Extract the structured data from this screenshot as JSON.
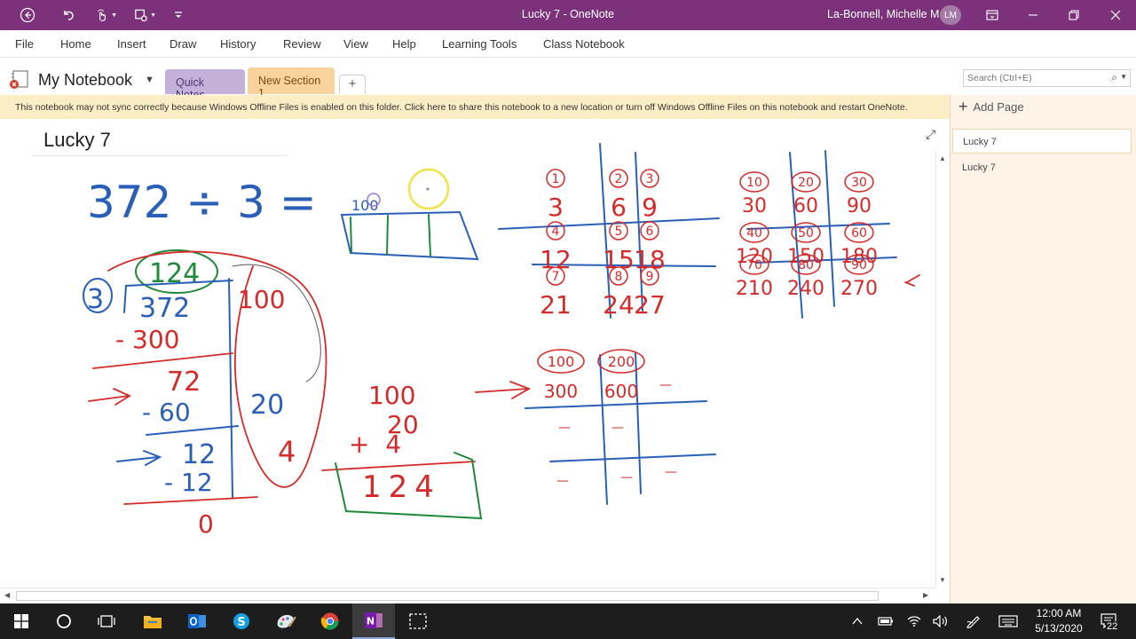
{
  "window": {
    "title": "Lucky 7  -  OneNote",
    "user_name": "La-Bonnell, Michelle M",
    "user_initials": "LM"
  },
  "menu": {
    "items": [
      "File",
      "Home",
      "Insert",
      "Draw",
      "History",
      "Review",
      "View",
      "Help",
      "Learning Tools",
      "Class Notebook"
    ]
  },
  "notebook": {
    "name": "My Notebook",
    "sections": [
      {
        "label": "Quick Notes",
        "color": "#c4b1d9"
      },
      {
        "label": "New Section 1",
        "color": "#f9d29c"
      }
    ],
    "add_section": "+"
  },
  "search": {
    "placeholder": "Search (Ctrl+E)"
  },
  "warning": {
    "text": "This notebook may not sync correctly because Windows Offline Files is enabled on this folder. Click here to share this notebook to a new location or turn off Windows Offline Files on this notebook and restart OneNote."
  },
  "page_pane": {
    "add_page": "Add Page",
    "pages": [
      "Lucky 7",
      "Lucky 7"
    ]
  },
  "page": {
    "title": "Lucky 7"
  },
  "ink_text": {
    "problem": "372 ÷ 3 =",
    "box_label": "100",
    "quotient": "124",
    "divisor": "3",
    "dividend": "372",
    "steps": [
      "- 300",
      "72",
      "- 60",
      "12",
      "- 12",
      "0"
    ],
    "partials": [
      "100",
      "20",
      "4"
    ],
    "sum_lines": [
      "100",
      "20",
      "+  4",
      "124"
    ],
    "table1_circles": [
      "1",
      "2",
      "3",
      "4",
      "5",
      "6",
      "7",
      "8",
      "9"
    ],
    "table1_values": [
      "3",
      "6",
      "9",
      "12",
      "15",
      "18",
      "21",
      "24",
      "27"
    ],
    "table2_circles": [
      "10",
      "20",
      "30",
      "40",
      "50",
      "60",
      "70",
      "80",
      "90"
    ],
    "table2_values": [
      "30",
      "60",
      "90",
      "120",
      "150",
      "180",
      "210",
      "240",
      "270"
    ],
    "table3_circles": [
      "100",
      "200"
    ],
    "table3_values": [
      "300",
      "600"
    ],
    "dashes": [
      "—",
      "—",
      "—",
      "—",
      "—",
      "—"
    ]
  },
  "taskbar": {
    "time": "12:00 AM",
    "date": "5/13/2020",
    "notification_count": "22"
  },
  "colors": {
    "title_bar": "#7b327b",
    "ink_blue": "#2a5fb8",
    "ink_red": "#d42a2a",
    "ink_green": "#1f8a3a",
    "highlight_yellow": "#f2e24a"
  }
}
